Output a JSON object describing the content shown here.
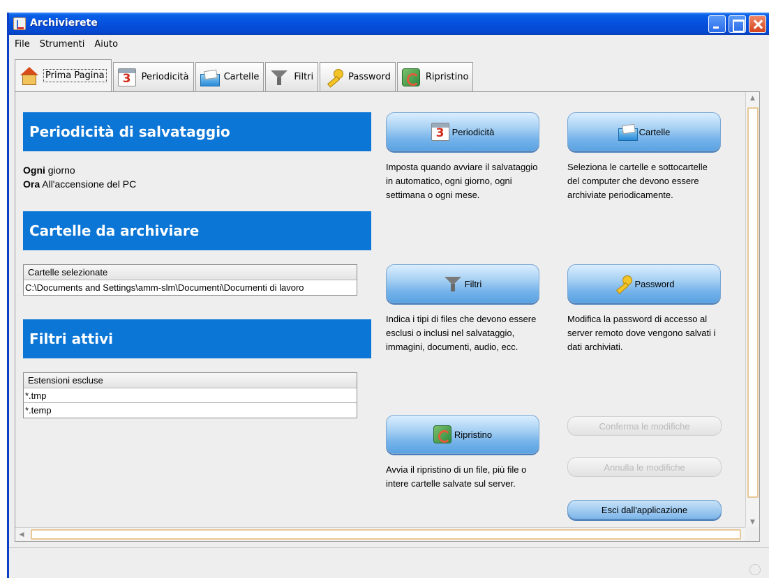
{
  "window": {
    "title": "Archivierete"
  },
  "menubar": {
    "items": [
      "File",
      "Strumenti",
      "Aiuto"
    ]
  },
  "tabs": [
    {
      "label": "Prima Pagina",
      "icon": "house-icon",
      "active": true
    },
    {
      "label": "Periodicità",
      "icon": "calendar-icon",
      "active": false
    },
    {
      "label": "Cartelle",
      "icon": "folder-icon",
      "active": false
    },
    {
      "label": "Filtri",
      "icon": "funnel-icon",
      "active": false
    },
    {
      "label": "Password",
      "icon": "key-icon",
      "active": false
    },
    {
      "label": "Ripristino",
      "icon": "restore-icon",
      "active": false
    }
  ],
  "left": {
    "periodicity": {
      "title": "Periodicità di salvataggio",
      "freq_label": "Ogni",
      "freq_value": "giorno",
      "time_label": "Ora",
      "time_value": "All'accensione del PC"
    },
    "folders": {
      "title": "Cartelle da archiviare",
      "column": "Cartelle selezionate",
      "rows": [
        "C:\\Documents and Settings\\amm-slm\\Documenti\\Documenti di lavoro"
      ]
    },
    "filters": {
      "title": "Filtri attivi",
      "column": "Estensioni escluse",
      "rows": [
        "*.tmp",
        "*.temp"
      ]
    }
  },
  "actions": {
    "periodicita": {
      "label": "Periodicità",
      "desc": "Imposta quando avviare il salvataggio in automatico, ogni giorno, ogni settimana o ogni mese."
    },
    "cartelle": {
      "label": "Cartelle",
      "desc": "Seleziona le cartelle e sottocartelle del computer che devono essere archiviate periodicamente."
    },
    "filtri": {
      "label": "Filtri",
      "desc": "Indica i tipi di files che devono essere esclusi o inclusi nel salvataggio, immagini, documenti, audio, ecc."
    },
    "password": {
      "label": "Password",
      "desc": "Modifica la password di accesso al server remoto dove vengono salvati i dati archiviati."
    },
    "ripristino": {
      "label": "Ripristino",
      "desc": "Avvia il ripristino di un file, più file o intere cartelle salvate sul server."
    }
  },
  "footer_buttons": {
    "confirm": "Conferma le modifiche",
    "cancel": "Annulla le modifiche",
    "exit": "Esci dall'applicazione"
  },
  "colors": {
    "section_header": "#0b76d6",
    "titlebar": "#0550dd"
  }
}
